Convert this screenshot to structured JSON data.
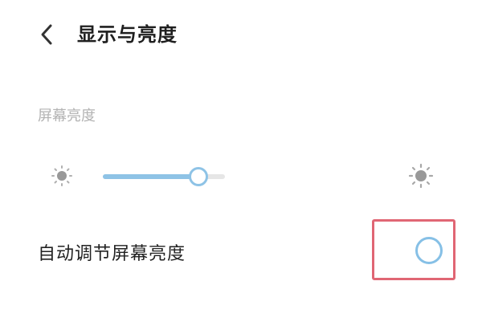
{
  "header": {
    "title": "显示与亮度",
    "back_icon": "chevron-left-icon"
  },
  "brightness": {
    "section_title": "屏幕亮度",
    "level": 0.78,
    "low_icon": "sun-dim-icon",
    "high_icon": "sun-bright-icon",
    "accent_color": "#8ec3e6"
  },
  "auto_brightness": {
    "label": "自动调节屏幕亮度",
    "enabled": false,
    "highlight_color": "#e06674"
  }
}
